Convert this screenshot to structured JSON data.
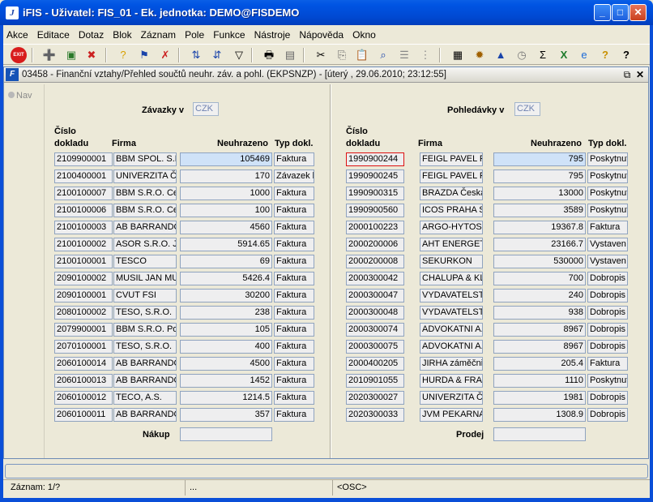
{
  "window": {
    "title": "iFIS - Uživatel: FIS_01 - Ek. jednotka: DEMO@FISDEMO"
  },
  "menu": [
    "Akce",
    "Editace",
    "Dotaz",
    "Blok",
    "Záznam",
    "Pole",
    "Funkce",
    "Nástroje",
    "Nápověda",
    "Okno"
  ],
  "toolbar": {
    "exit_label": "EXIT"
  },
  "form": {
    "title": "03458 - Finanční vztahy/Přehled součtů neuhr. záv. a pohl. (EKPSNZP) - [úterý  , 29.06.2010; 23:12:55]",
    "nav_label": "Nav"
  },
  "zavazky": {
    "heading": "Závazky v",
    "currency": "CZK",
    "col_cislo_1": "Číslo",
    "col_cislo_2": "dokladu",
    "col_firma": "Firma",
    "col_neuhrazeno": "Neuhrazeno",
    "col_typ": "Typ dokl.",
    "rows": [
      {
        "cislo": "2109900001",
        "firma": "BBM SPOL. S.R.O.",
        "neuhrazeno": "105469",
        "typ": "Faktura"
      },
      {
        "cislo": "2100400001",
        "firma": "UNIVERZITA Čá",
        "neuhrazeno": "170",
        "typ": "Závazek k"
      },
      {
        "cislo": "2100100007",
        "firma": "BBM S.R.O. Cer",
        "neuhrazeno": "1000",
        "typ": "Faktura"
      },
      {
        "cislo": "2100100006",
        "firma": "BBM S.R.O. Cer",
        "neuhrazeno": "100",
        "typ": "Faktura"
      },
      {
        "cislo": "2100100003",
        "firma": "AB BARRANDO",
        "neuhrazeno": "4560",
        "typ": "Faktura"
      },
      {
        "cislo": "2100100002",
        "firma": "ASOR S.R.O. Ji",
        "neuhrazeno": "5914.65",
        "typ": "Faktura"
      },
      {
        "cislo": "2100100001",
        "firma": "TESCO",
        "neuhrazeno": "69",
        "typ": "Faktura"
      },
      {
        "cislo": "2090100002",
        "firma": "MUSIL JAN MUD",
        "neuhrazeno": "5426.4",
        "typ": "Faktura"
      },
      {
        "cislo": "2090100001",
        "firma": "CVUT FSI",
        "neuhrazeno": "30200",
        "typ": "Faktura"
      },
      {
        "cislo": "2080100002",
        "firma": "TESO, S.R.O.",
        "neuhrazeno": "238",
        "typ": "Faktura"
      },
      {
        "cislo": "2079900001",
        "firma": "BBM S.R.O. Pok",
        "neuhrazeno": "105",
        "typ": "Faktura"
      },
      {
        "cislo": "2070100001",
        "firma": "TESO, S.R.O.",
        "neuhrazeno": "400",
        "typ": "Faktura"
      },
      {
        "cislo": "2060100014",
        "firma": "AB BARRANDO",
        "neuhrazeno": "4500",
        "typ": "Faktura"
      },
      {
        "cislo": "2060100013",
        "firma": "AB BARRANDO",
        "neuhrazeno": "1452",
        "typ": "Faktura"
      },
      {
        "cislo": "2060100012",
        "firma": "TECO, A.S.",
        "neuhrazeno": "1214.5",
        "typ": "Faktura"
      },
      {
        "cislo": "2060100011",
        "firma": "AB BARRANDO",
        "neuhrazeno": "357",
        "typ": "Faktura"
      }
    ],
    "total_label": "Nákup",
    "total_value": ""
  },
  "pohledavky": {
    "heading": "Pohledávky v",
    "currency": "CZK",
    "col_cislo_1": "Číslo",
    "col_cislo_2": "dokladu",
    "col_firma": "Firma",
    "col_neuhrazeno": "Neuhrazeno",
    "col_typ": "Typ dokl.",
    "rows": [
      {
        "cislo": "1990900244",
        "firma": "FEIGL PAVEL PHI",
        "neuhrazeno": "795",
        "typ": "Poskytnut"
      },
      {
        "cislo": "1990900245",
        "firma": "FEIGL PAVEL PHI",
        "neuhrazeno": "795",
        "typ": "Poskytnut"
      },
      {
        "cislo": "1990900315",
        "firma": "BRAZDA Česká s",
        "neuhrazeno": "13000",
        "typ": "Poskytnut"
      },
      {
        "cislo": "1990900560",
        "firma": "ICOS PRAHA S.R",
        "neuhrazeno": "3589",
        "typ": "Poskytnut"
      },
      {
        "cislo": "2000100223",
        "firma": "ARGO-HYTOS, A",
        "neuhrazeno": "19367.8",
        "typ": "Faktura"
      },
      {
        "cislo": "2000200006",
        "firma": "AHT ENERGETIKA",
        "neuhrazeno": "23166.7",
        "typ": "Vystaven"
      },
      {
        "cislo": "2000200008",
        "firma": "SEKURKON",
        "neuhrazeno": "530000",
        "typ": "Vystaven"
      },
      {
        "cislo": "2000300042",
        "firma": "CHALUPA & KLIM",
        "neuhrazeno": "700",
        "typ": "Dobropis"
      },
      {
        "cislo": "2000300047",
        "firma": "VYDAVATELSTV",
        "neuhrazeno": "240",
        "typ": "Dobropis"
      },
      {
        "cislo": "2000300048",
        "firma": "VYDAVATELSTV",
        "neuhrazeno": "938",
        "typ": "Dobropis"
      },
      {
        "cislo": "2000300074",
        "firma": "ADVOKATNI A.D.",
        "neuhrazeno": "8967",
        "typ": "Dobropis"
      },
      {
        "cislo": "2000300075",
        "firma": "ADVOKATNI A.D.",
        "neuhrazeno": "8967",
        "typ": "Dobropis"
      },
      {
        "cislo": "2000400205",
        "firma": "JIRHA záměčnick",
        "neuhrazeno": "205.4",
        "typ": "Faktura"
      },
      {
        "cislo": "2010901055",
        "firma": "HURDA & FRANK",
        "neuhrazeno": "1110",
        "typ": "Poskytnut"
      },
      {
        "cislo": "2020300027",
        "firma": "UNIVERZITA Část",
        "neuhrazeno": "1981",
        "typ": "Dobropis"
      },
      {
        "cislo": "2020300033",
        "firma": "JVM PEKARNA",
        "neuhrazeno": "1308.9",
        "typ": "Dobropis"
      }
    ],
    "total_label": "Prodej",
    "total_value": ""
  },
  "status": {
    "record": "Záznam: 1/?",
    "ellipsis": "...",
    "osc": "<OSC>"
  }
}
